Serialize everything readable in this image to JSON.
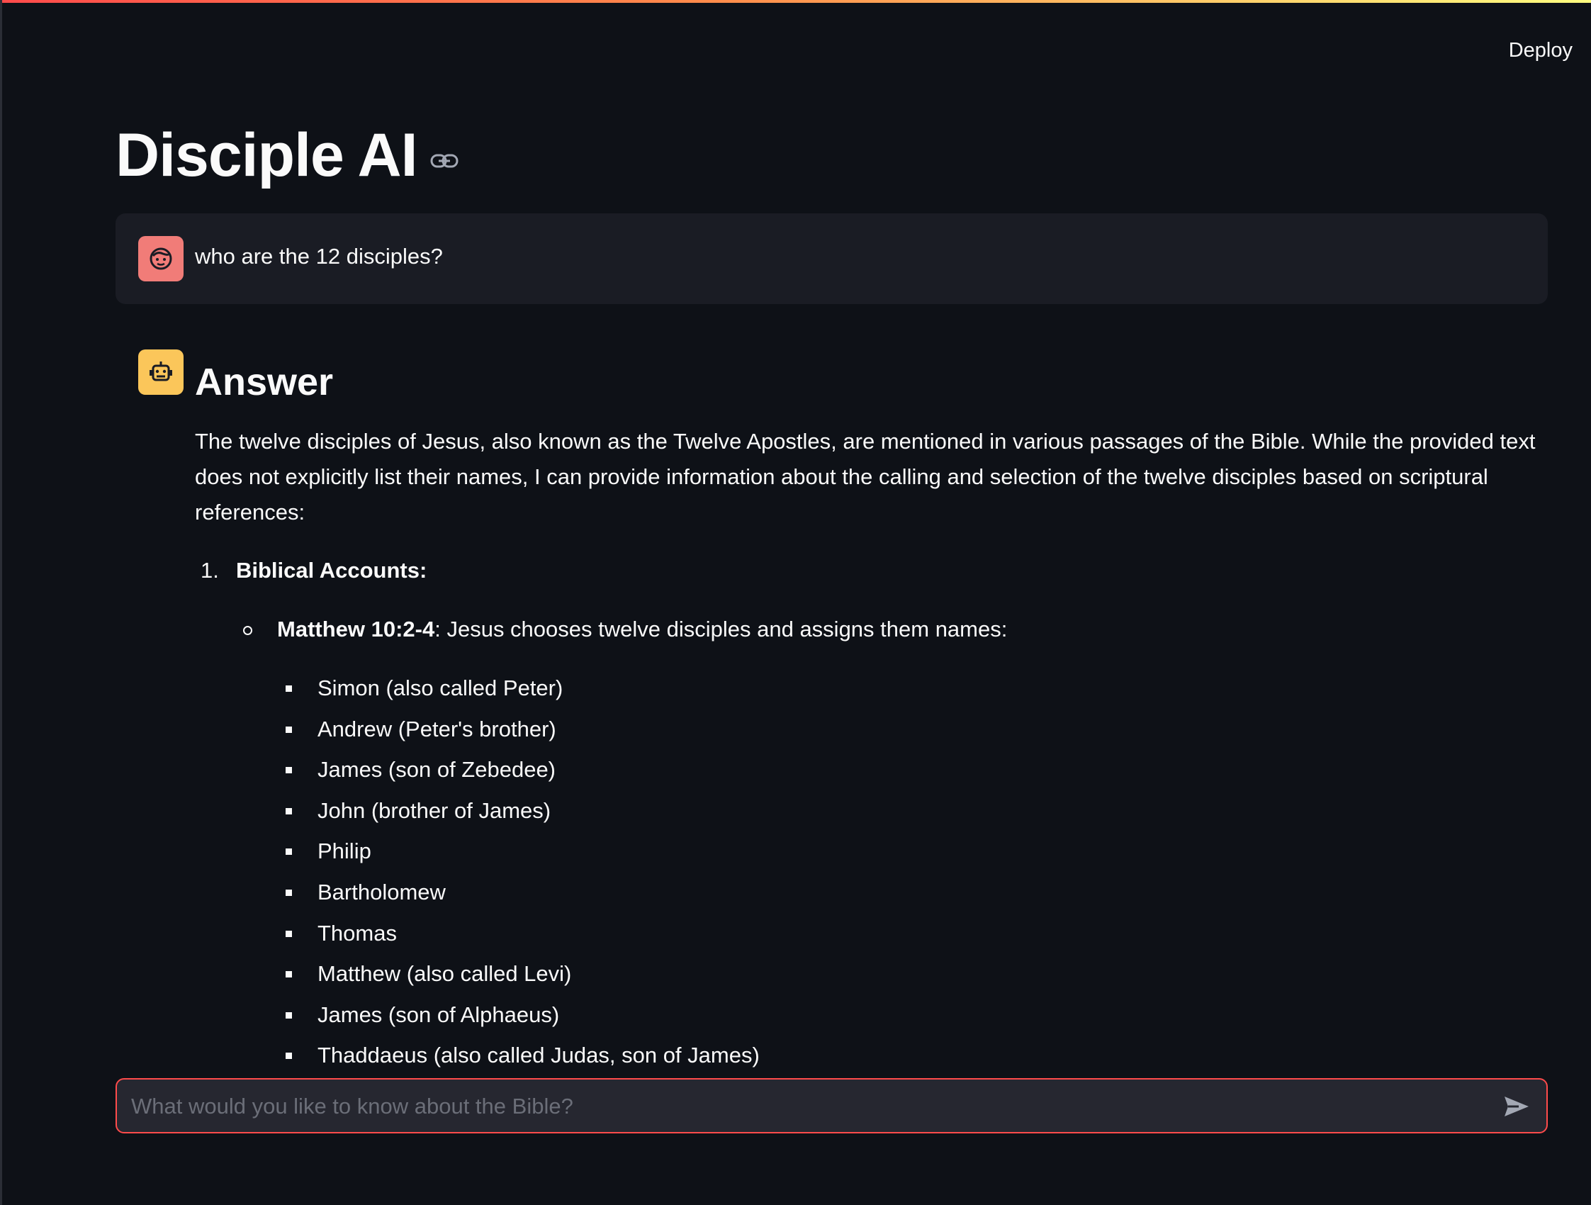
{
  "header": {
    "deploy_label": "Deploy"
  },
  "app": {
    "title": "Disciple AI"
  },
  "icons": {
    "link": "link-icon",
    "user_avatar": "face-icon",
    "bot_avatar": "robot-icon",
    "send": "send-icon"
  },
  "colors": {
    "background": "#0e1117",
    "user_bubble": "#1a1c24",
    "user_avatar": "#f17c78",
    "bot_avatar": "#fbc65a",
    "input_border": "#ff4b4b"
  },
  "messages": {
    "user": {
      "text": "who are the 12 disciples?"
    },
    "assistant": {
      "heading": "Answer",
      "intro": "The twelve disciples of Jesus, also known as the Twelve Apostles, are mentioned in various passages of the Bible. While the provided text does not explicitly list their names, I can provide information about the calling and selection of the twelve disciples based on scriptural references:",
      "list_number": "1.",
      "list_title": "Biblical Accounts:",
      "sub_ref": "Matthew 10:2-4",
      "sub_text": ": Jesus chooses twelve disciples and assigns them names:",
      "names": [
        "Simon (also called Peter)",
        "Andrew (Peter's brother)",
        "James (son of Zebedee)",
        "John (brother of James)",
        "Philip",
        "Bartholomew",
        "Thomas",
        "Matthew (also called Levi)",
        "James (son of Alphaeus)",
        "Thaddaeus (also called Judas, son of James)"
      ]
    }
  },
  "chat_input": {
    "placeholder": "What would you like to know about the Bible?",
    "value": ""
  }
}
